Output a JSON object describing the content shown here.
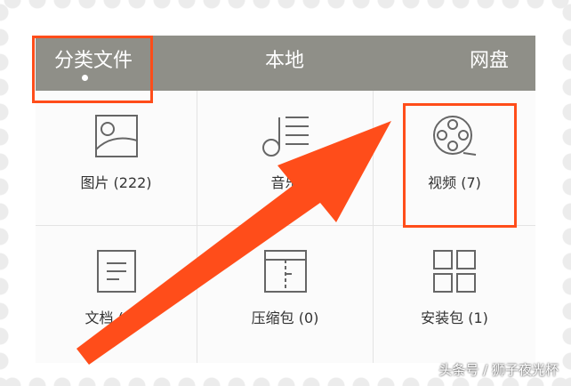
{
  "tabs": [
    {
      "label": "分类文件",
      "selected": true
    },
    {
      "label": "本地",
      "selected": false
    },
    {
      "label": "网盘",
      "selected": false
    }
  ],
  "grid": [
    {
      "label": "图片 (222)",
      "icon": "image-icon"
    },
    {
      "label": "音乐",
      "icon": "music-icon"
    },
    {
      "label": "视频 (7)",
      "icon": "film-reel-icon"
    },
    {
      "label": "文档 (14)",
      "icon": "document-icon"
    },
    {
      "label": "压缩包 (0)",
      "icon": "archive-icon"
    },
    {
      "label": "安装包 (1)",
      "icon": "apps-grid-icon"
    }
  ],
  "annotation": {
    "arrow_color": "#ff4d1a",
    "highlight_color": "#ff4d1a"
  },
  "watermark": "头条号 / 狮子夜光杯"
}
